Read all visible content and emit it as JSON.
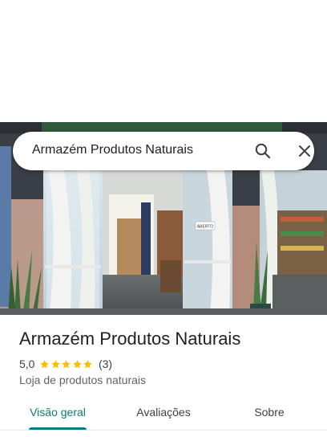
{
  "search": {
    "query": "Armazém Produtos Naturais"
  },
  "photo": {
    "door_sign": "ABERTO"
  },
  "place": {
    "title": "Armazém Produtos Naturais",
    "rating": "5,0",
    "stars": 5,
    "review_count": "(3)",
    "category": "Loja de produtos naturais"
  },
  "tabs": [
    {
      "label": "Visão geral",
      "selected": true
    },
    {
      "label": "Avaliações",
      "selected": false
    },
    {
      "label": "Sobre",
      "selected": false
    }
  ],
  "colors": {
    "accent": "#0b7b80",
    "star": "#fbbc04"
  }
}
